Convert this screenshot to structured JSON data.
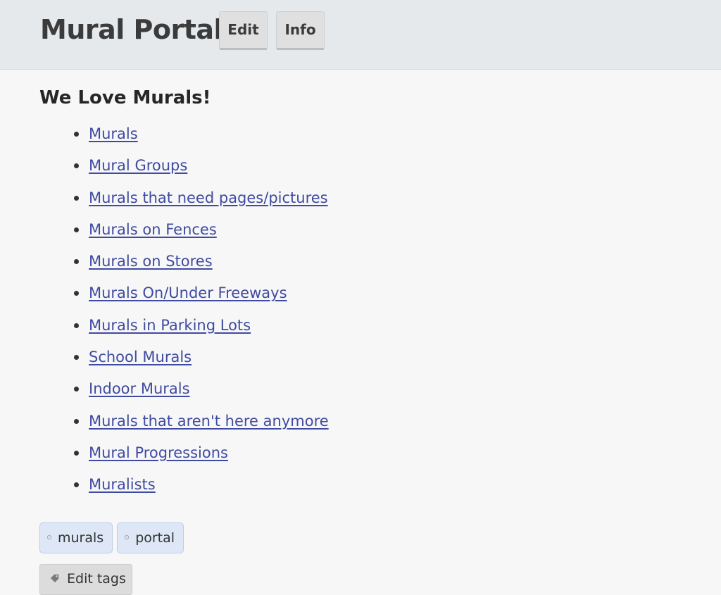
{
  "header": {
    "site_title": "Mural Portal",
    "edit_label": "Edit",
    "info_label": "Info"
  },
  "main": {
    "heading": "We Love Murals!",
    "links": [
      "Murals",
      "Mural Groups",
      "Murals that need pages/pictures",
      "Murals on Fences",
      "Murals on Stores",
      "Murals On/Under Freeways",
      "Murals in Parking Lots",
      "School Murals",
      "Indoor Murals",
      "Murals that aren't here anymore",
      "Mural Progressions",
      "Muralists"
    ]
  },
  "tags": {
    "items": [
      "murals",
      "portal"
    ],
    "edit_label": "Edit tags"
  },
  "colors": {
    "link": "#3f4ba0",
    "header_bg": "#e6e9ec",
    "tag_bg": "#dde7f6"
  }
}
